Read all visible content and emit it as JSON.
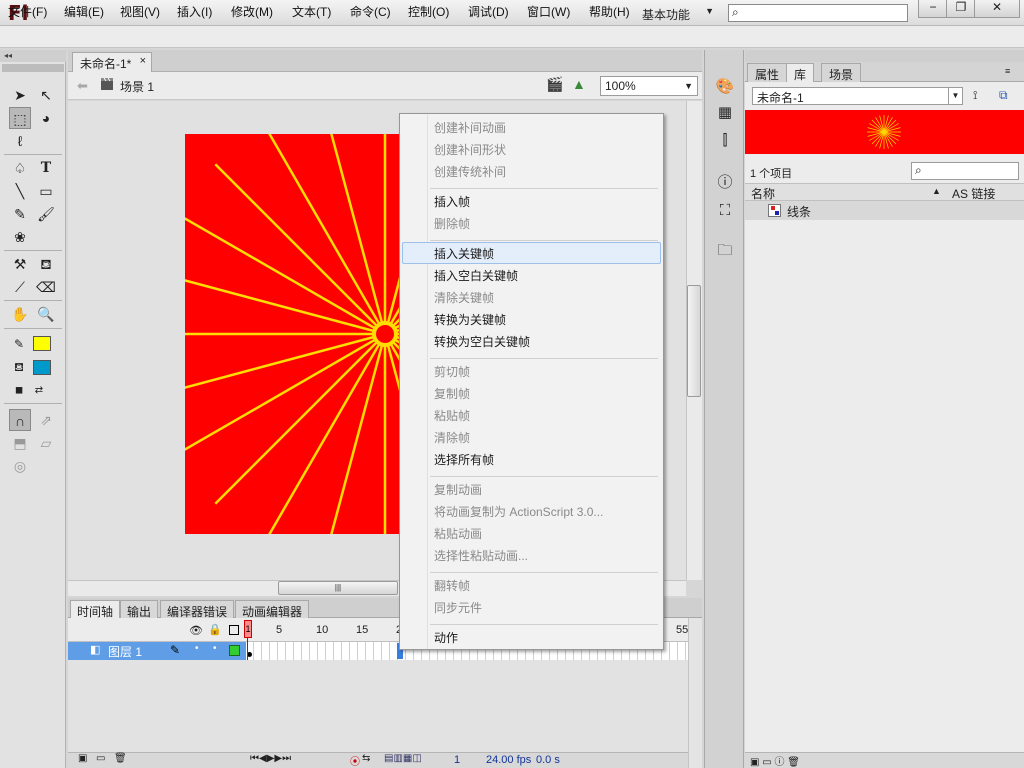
{
  "app": {
    "logo": "Fl",
    "workspace": "基本功能",
    "search_icon": "⌕",
    "win_min": "−",
    "win_max": "❐",
    "win_close": "✕"
  },
  "menubar": [
    "文件(F)",
    "编辑(E)",
    "视图(V)",
    "插入(I)",
    "修改(M)",
    "文本(T)",
    "命令(C)",
    "控制(O)",
    "调试(D)",
    "窗口(W)",
    "帮助(H)"
  ],
  "document": {
    "tab_title": "未命名-1*",
    "tab_close": "×",
    "scene": "场景 1",
    "zoom": "100%"
  },
  "stage": {
    "background": "#ff0000",
    "line_color": "#ffdd00",
    "ray_count": 24
  },
  "timeline": {
    "tabs": [
      "时间轴",
      "输出",
      "编译器错误",
      "动画编辑器"
    ],
    "ruler": [
      "1",
      "5",
      "10",
      "15",
      "2",
      "55"
    ],
    "layer_name": "图层 1",
    "fps": "24.00 fps",
    "current_frame": "1",
    "time": "0.0 s"
  },
  "library": {
    "tabs": [
      "属性",
      "库",
      "场景"
    ],
    "document": "未命名-1",
    "count": "1 个项目",
    "col_name": "名称",
    "col_link": "AS 链接",
    "items": [
      {
        "name": "线条"
      }
    ]
  },
  "context_menu": {
    "groups": [
      [
        {
          "label": "创建补间动画",
          "enabled": false
        },
        {
          "label": "创建补间形状",
          "enabled": false
        },
        {
          "label": "创建传统补间",
          "enabled": false
        }
      ],
      [
        {
          "label": "插入帧",
          "enabled": true
        },
        {
          "label": "删除帧",
          "enabled": false
        }
      ],
      [
        {
          "label": "插入关键帧",
          "enabled": true
        },
        {
          "label": "插入空白关键帧",
          "enabled": true
        },
        {
          "label": "清除关键帧",
          "enabled": false
        },
        {
          "label": "转换为关键帧",
          "enabled": true
        },
        {
          "label": "转换为空白关键帧",
          "enabled": true
        }
      ],
      [
        {
          "label": "剪切帧",
          "enabled": false
        },
        {
          "label": "复制帧",
          "enabled": false
        },
        {
          "label": "粘贴帧",
          "enabled": false
        },
        {
          "label": "清除帧",
          "enabled": false
        },
        {
          "label": "选择所有帧",
          "enabled": true
        }
      ],
      [
        {
          "label": "复制动画",
          "enabled": false
        },
        {
          "label": "将动画复制为 ActionScript 3.0...",
          "enabled": false
        },
        {
          "label": "粘贴动画",
          "enabled": false
        },
        {
          "label": "选择性粘贴动画...",
          "enabled": false
        }
      ],
      [
        {
          "label": "翻转帧",
          "enabled": false
        },
        {
          "label": "同步元件",
          "enabled": false
        }
      ],
      [
        {
          "label": "动作",
          "enabled": true
        }
      ]
    ],
    "highlighted": "插入关键帧"
  },
  "colors": {
    "stroke_swatch": "#ffff00",
    "fill_swatch": "#0099cc"
  }
}
